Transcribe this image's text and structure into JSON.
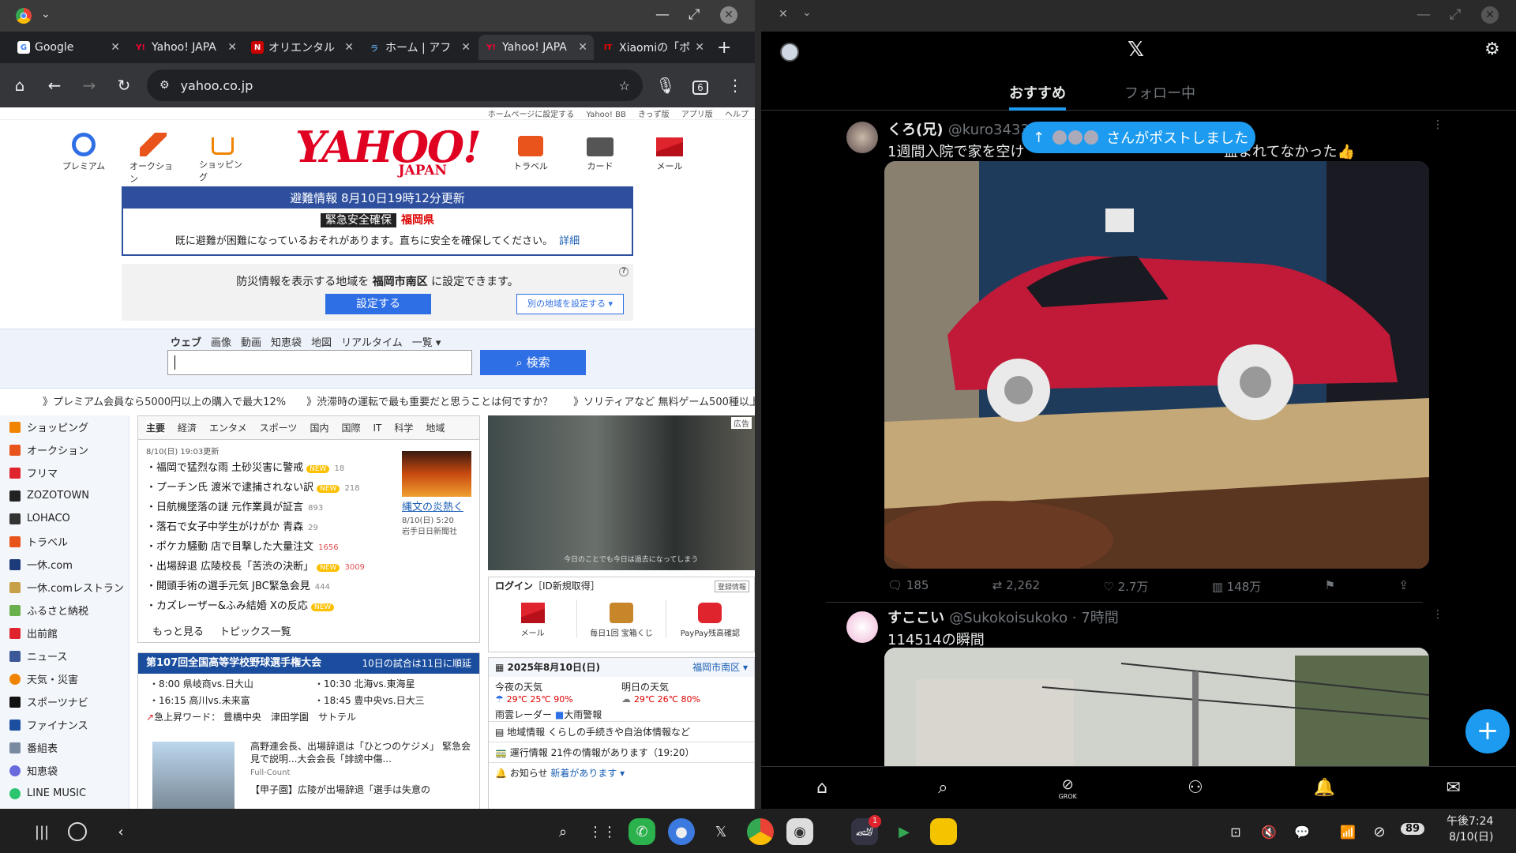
{
  "browser": {
    "tabs": [
      {
        "title": "Google",
        "fav": "G",
        "favcolor": "#4285f4"
      },
      {
        "title": "Yahoo! JAPA",
        "fav": "Y!",
        "favcolor": "#ff0033"
      },
      {
        "title": "オリエンタル",
        "fav": "N",
        "favcolor": "#c00"
      },
      {
        "title": "ホーム | アフ",
        "fav": "ラ",
        "favcolor": "#5a9bd5"
      },
      {
        "title": "Yahoo! JAPA",
        "fav": "Y!",
        "favcolor": "#ff0033"
      },
      {
        "title": "Xiaomiの「ポ",
        "fav": "IT",
        "favcolor": "#e00"
      }
    ],
    "url": "yahoo.co.jp",
    "tab_count": "6"
  },
  "yahoo": {
    "toplinks": [
      "ホームページに設定する",
      "Yahoo! BB",
      "きっず版",
      "アプリ版",
      "ヘルプ"
    ],
    "services_left": [
      "プレミアム",
      "オークション",
      "ショッピング"
    ],
    "services_right": [
      "トラベル",
      "カード",
      "メール"
    ],
    "logo": "YAHOO!",
    "logo_sub": "JAPAN",
    "alert": {
      "header": "避難情報 8月10日19時12分更新",
      "level": "緊急安全確保",
      "pref": "福岡県",
      "message": "既に避難が困難になっているおそれがあります。直ちに安全を確保してください。",
      "detail": "詳細"
    },
    "region": {
      "text_pre": "防災情報を表示する地域を ",
      "area": "福岡市南区",
      "text_post": " に設定できます。",
      "set_button": "設定する",
      "other_button": "別の地域を設定する ▾"
    },
    "search": {
      "tabs": [
        "ウェブ",
        "画像",
        "動画",
        "知恵袋",
        "地図",
        "リアルタイム",
        "一覧 ▾"
      ],
      "button": "検索",
      "value": ""
    },
    "promos": [
      "》プレミアム会員なら5000円以上の購入で最大12%",
      "》渋滞時の運転で最も重要だと思うことは何ですか？",
      "》ソリティアなど 無料ゲーム500種以上"
    ],
    "nav": [
      {
        "label": "ショッピング",
        "color": "#f08300"
      },
      {
        "label": "オークション",
        "color": "#e8541b"
      },
      {
        "label": "フリマ",
        "color": "#e0242d"
      },
      {
        "label": "ZOZOTOWN",
        "color": "#222"
      },
      {
        "label": "LOHACO",
        "color": "#333"
      },
      {
        "label": "トラベル",
        "color": "#e8541b"
      },
      {
        "label": "一休.com",
        "color": "#1d3a7a"
      },
      {
        "label": "一休.comレストラン",
        "color": "#c8a04a"
      },
      {
        "label": "ふるさと納税",
        "color": "#6ab04c"
      },
      {
        "label": "出前館",
        "color": "#e0242d"
      },
      {
        "label": "ニュース",
        "color": "#3b5998"
      },
      {
        "label": "天気・災害",
        "color": "#f08300"
      },
      {
        "label": "スポーツナビ",
        "color": "#111"
      },
      {
        "label": "ファイナンス",
        "color": "#1d4fa0"
      },
      {
        "label": "番組表",
        "color": "#7a8aa0"
      },
      {
        "label": "知恵袋",
        "color": "#6a6adf"
      },
      {
        "label": "LINE MUSIC",
        "color": "#2cc56f"
      }
    ],
    "news": {
      "tabs": [
        "主要",
        "経済",
        "エンタメ",
        "スポーツ",
        "国内",
        "国際",
        "IT",
        "科学",
        "地域"
      ],
      "date": "8/10(日) 19:03更新",
      "items": [
        {
          "text": "・福岡で猛烈な雨 土砂災害に警戒",
          "new": "NEW",
          "count": "18",
          "hot": false
        },
        {
          "text": "・プーチン氏 渡米で逮捕されない訳",
          "new": "NEW",
          "count": "218",
          "hot": false
        },
        {
          "text": "・日航機墜落の謎 元作業員が証言",
          "new": "",
          "count": "893",
          "hot": false
        },
        {
          "text": "・落石で女子中学生がけがか 青森",
          "new": "",
          "count": "29",
          "hot": false
        },
        {
          "text": "・ポケカ騒動 店で目撃した大量注文",
          "new": "",
          "count": "1656",
          "hot": true
        },
        {
          "text": "・出場辞退 広陵校長「苦渋の決断」",
          "new": "NEW",
          "count": "3009",
          "hot": true
        },
        {
          "text": "・開頭手術の選手元気 JBC緊急会見",
          "new": "",
          "count": "444",
          "hot": false
        },
        {
          "text": "・カズレーザー&ふみ結婚 Xの反応",
          "new": "NEW",
          "count": "",
          "hot": false
        }
      ],
      "more": "もっと見る",
      "list": "トピックス一覧",
      "thumb_caption": "縄文の炎熱く",
      "thumb_date": "8/10(日) 5:20",
      "thumb_source": "岩手日日新聞社"
    },
    "koshien": {
      "title": "第107回全国高等学校野球選手権大会",
      "right": "10日の試合は11日に順延",
      "games": [
        "・8:00 県岐商vs.日大山",
        "・10:30 北海vs.東海星",
        "・16:15 高川vs.未来富",
        "・18:45 豊中央vs.日大三"
      ],
      "trend_label": "急上昇ワード：",
      "trends": [
        "豊橋中央",
        "津田学園",
        "サトテル"
      ],
      "article": "高野連会長、出場辞退は「ひとつのケジメ」 緊急会見で説明...大会会長「誹謗中傷...",
      "article_src": "Full-Count",
      "article2": "【甲子園】広陵が出場辞退「選手は失意の"
    },
    "ad": {
      "tag": "広告",
      "caption": "今日のことでも今日は過去になってしまう"
    },
    "login": {
      "title": "ログイン",
      "register": "［ID新規取得］",
      "info": "登録情報",
      "items": [
        "メール",
        "毎日1回 宝箱くじ",
        "PayPay残高確認"
      ]
    },
    "weather": {
      "date": "2025年8月10日(日)",
      "area": "福岡市南区 ▾",
      "tonight_label": "今夜の天気",
      "tonight": "29℃ 25℃ 90%",
      "tomorrow_label": "明日の天気",
      "tomorrow": "29℃ 26℃ 80%",
      "radar": "雨雲レーダー",
      "warning": "大雨警報",
      "local": "地域情報",
      "local_text": "くらしの手続きや自治体情報など",
      "transit": "運行情報",
      "transit_text": "21件の情報があります（19:20）",
      "notice": "お知らせ",
      "notice_text": "新着があります ▾"
    }
  },
  "x": {
    "tabs": [
      "おすすめ",
      "フォロー中"
    ],
    "reposted_pill": "さんがポストしました",
    "post1": {
      "name": "くろ(兄)",
      "handle": "@kuro3433",
      "text_left": "1週間入院で家を空け",
      "text_right": "盗まれてなかった👍",
      "replies": "185",
      "reposts": "2,262",
      "likes": "2.7万",
      "views": "148万"
    },
    "post2": {
      "name": "すここい",
      "handle": "@Sukokoisukoko · 7時間",
      "text": "114514の瞬間"
    },
    "bottom_labels": [
      "GROK"
    ]
  },
  "taskbar": {
    "time": "午後7:24",
    "date": "8/10(日)",
    "battery": "89",
    "badge": "1"
  }
}
